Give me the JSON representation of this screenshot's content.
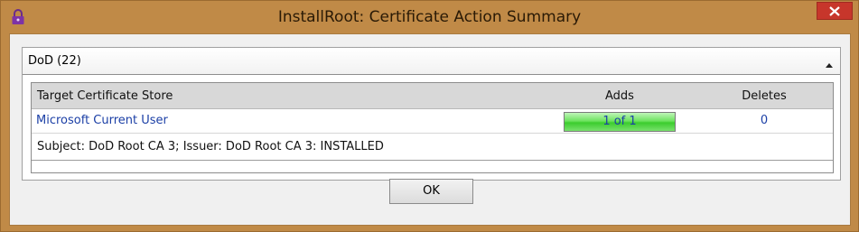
{
  "window": {
    "title": "InstallRoot: Certificate Action Summary",
    "app_icon": "padlock-icon",
    "close_icon": "close-icon",
    "accent_color": "#c08a47",
    "close_color": "#c7362b"
  },
  "group": {
    "title": "DoD (22)",
    "collapse_icon": "chevron-up-icon"
  },
  "table": {
    "columns": {
      "store": "Target Certificate Store",
      "adds": "Adds",
      "deletes": "Deletes"
    },
    "rows": [
      {
        "store": "Microsoft Current User",
        "adds": "1 of 1",
        "adds_progress_percent": 100,
        "deletes": "0",
        "detail": "Subject: DoD Root CA 3; Issuer: DoD Root CA 3: INSTALLED"
      }
    ]
  },
  "buttons": {
    "ok": "OK"
  }
}
